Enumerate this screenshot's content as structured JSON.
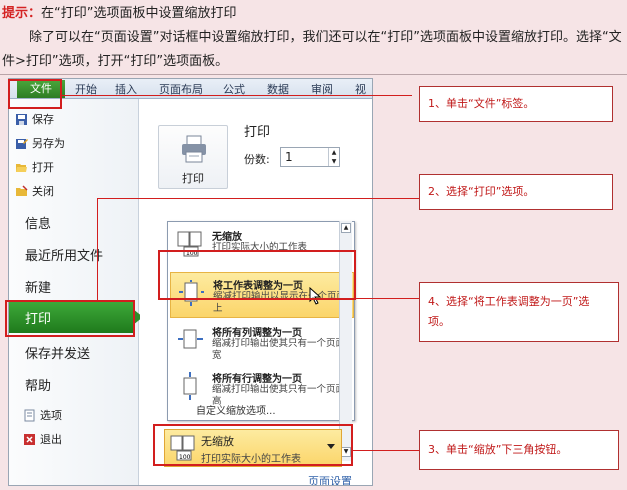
{
  "tip": {
    "label": "提示：",
    "text": "在“打印”选项面板中设置缩放打印"
  },
  "paragraph": "除了可以在“页面设置”对话框中设置缩放打印，我们还可以在“打印”选项面板中设置缩放打印。选择“文件>打印”选项，打开“打印”选项面板。",
  "ribbon_tabs": [
    "文件",
    "开始",
    "插入",
    "页面布局",
    "公式",
    "数据",
    "审阅",
    "视图"
  ],
  "sidebar": {
    "small_items": [
      "保存",
      "另存为",
      "打开",
      "关闭"
    ],
    "info": "信息",
    "recent": "最近所用文件",
    "new": "新建",
    "print": "打印",
    "save_send": "保存并发送",
    "help": "帮助",
    "options": "选项",
    "exit": "退出"
  },
  "print_panel": {
    "title": "打印",
    "button_label": "打印",
    "copies_label": "份数:",
    "copies_value": "1"
  },
  "scaling_options": [
    {
      "title": "无缩放",
      "desc": "打印实际大小的工作表"
    },
    {
      "title": "将工作表调整为一页",
      "desc": "缩减打印输出以显示在一个页面上"
    },
    {
      "title": "将所有列调整为一页",
      "desc": "缩减打印输出使其只有一个页面宽"
    },
    {
      "title": "将所有行调整为一页",
      "desc": "缩减打印输出使其只有一个页面高"
    }
  ],
  "custom_scaling": "自定义缩放选项...",
  "current_scaling": {
    "title": "无缩放",
    "desc": "打印实际大小的工作表"
  },
  "page_setup_link": "页面设置",
  "callouts": {
    "c1": "1、单击“文件”标签。",
    "c2": "2、选择“打印”选项。",
    "c3": "3、单击“缩放”下三角按钮。",
    "c4": "4、选择“将工作表调整为一页”选项。"
  },
  "colors": {
    "accent_red": "#d21e1e",
    "file_green": "#2e7d24",
    "highlight": "#fbd56a"
  }
}
